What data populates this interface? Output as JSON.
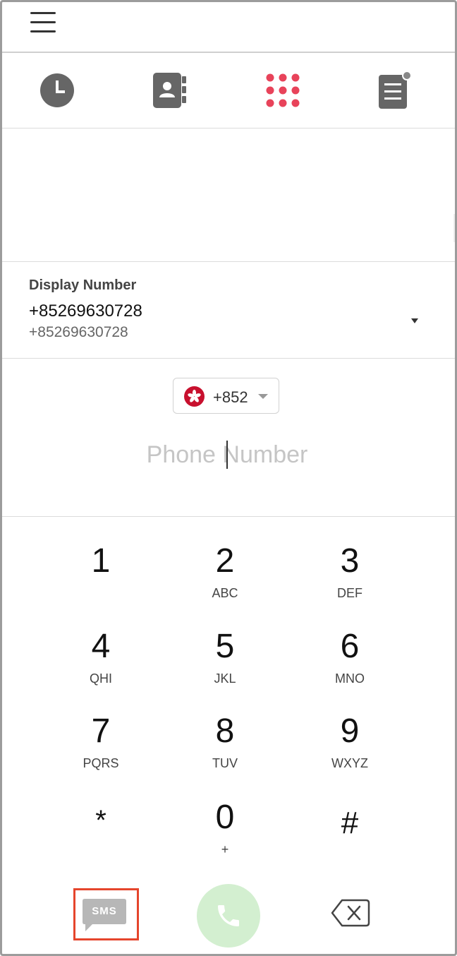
{
  "nav": {
    "menu": "menu",
    "tabs": [
      {
        "id": "history",
        "icon": "clock-icon",
        "active": false
      },
      {
        "id": "contacts",
        "icon": "contact-book-icon",
        "active": false
      },
      {
        "id": "dialpad",
        "icon": "dialpad-icon",
        "active": true
      },
      {
        "id": "notes",
        "icon": "notes-icon",
        "active": false,
        "notification_dot": true
      }
    ]
  },
  "display_number": {
    "label": "Display Number",
    "primary": "+85269630728",
    "secondary": "+85269630728"
  },
  "country": {
    "code": "+852",
    "flag_icon": "hong-kong-flag-icon"
  },
  "phone_input": {
    "placeholder": "Phone Number",
    "value": ""
  },
  "keypad": [
    {
      "digit": "1",
      "letters": ""
    },
    {
      "digit": "2",
      "letters": "ABC"
    },
    {
      "digit": "3",
      "letters": "DEF"
    },
    {
      "digit": "4",
      "letters": "QHI"
    },
    {
      "digit": "5",
      "letters": "JKL"
    },
    {
      "digit": "6",
      "letters": "MNO"
    },
    {
      "digit": "7",
      "letters": "PQRS"
    },
    {
      "digit": "8",
      "letters": "TUV"
    },
    {
      "digit": "9",
      "letters": "WXYZ"
    },
    {
      "digit": "*",
      "letters": ""
    },
    {
      "digit": "0",
      "letters": "+"
    },
    {
      "digit": "#",
      "letters": ""
    }
  ],
  "actions": {
    "sms_label": "SMS",
    "call_icon": "phone-icon",
    "backspace_icon": "backspace-icon"
  },
  "colors": {
    "accent": "#e8435a",
    "icon_gray": "#666666",
    "call_green_light": "#d3efd0",
    "highlight_border": "#e5452c"
  }
}
